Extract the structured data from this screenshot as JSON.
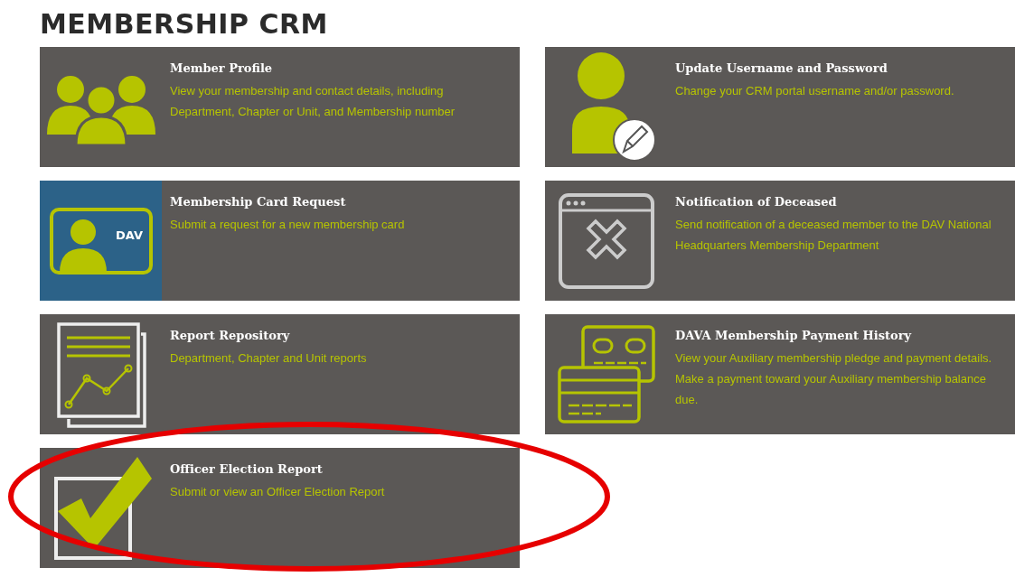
{
  "page_title": "MEMBERSHIP CRM",
  "cards": [
    {
      "kind": "members",
      "title": "Member Profile",
      "description": "View your membership and contact details, including Department, Chapter or Unit, and Membership number",
      "highlighted": false
    },
    {
      "kind": "user-edit",
      "title": "Update Username and Password",
      "description": "Change your CRM portal username and/or password.",
      "highlighted": false
    },
    {
      "kind": "member-card",
      "badge": "DAV",
      "title": "Membership Card Request",
      "description": "Submit a request for a new membership card",
      "highlighted": false
    },
    {
      "kind": "window-x",
      "title": "Notification of Deceased",
      "description": "Send notification of a deceased member to the DAV National Headquarters Membership Department",
      "highlighted": false
    },
    {
      "kind": "report",
      "title": "Report Repository",
      "description": "Department, Chapter and Unit reports",
      "highlighted": false
    },
    {
      "kind": "credit-cards",
      "title": "DAVA Membership Payment History",
      "description": "View your Auxiliary membership pledge and payment details. Make a payment toward your Auxiliary membership balance due.",
      "highlighted": false
    },
    {
      "kind": "checkmark",
      "title": "Officer Election Report",
      "description": "Submit or view an Officer Election Report",
      "highlighted": true
    }
  ]
}
